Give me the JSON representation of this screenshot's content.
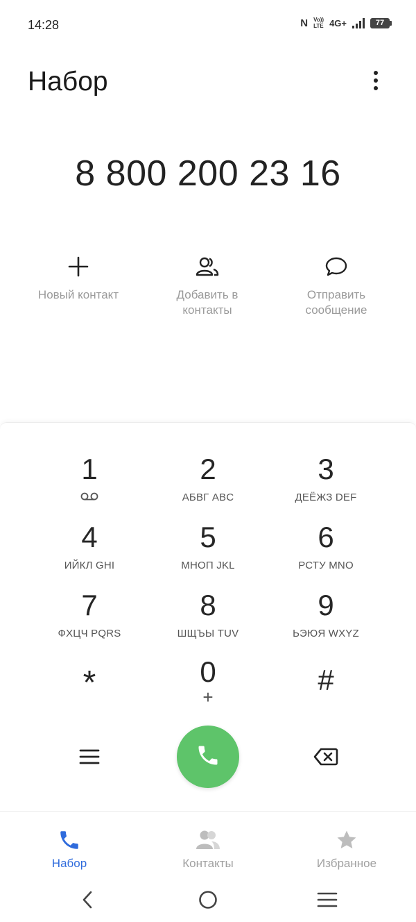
{
  "status_bar": {
    "time": "14:28",
    "nfc": "N",
    "volte_top": "Vo))",
    "volte_bottom": "LTE",
    "network": "4G+",
    "battery": "77"
  },
  "header": {
    "title": "Набор"
  },
  "dialed_number": "8 800 200 23 16",
  "actions": {
    "new_contact": "Новый контакт",
    "add_to_contacts": "Добавить в контакты",
    "send_message": "Отправить сообщение"
  },
  "keypad": [
    {
      "digit": "1",
      "letters": ""
    },
    {
      "digit": "2",
      "letters": "АБВГ ABC"
    },
    {
      "digit": "3",
      "letters": "ДЕЁЖЗ DEF"
    },
    {
      "digit": "4",
      "letters": "ИЙКЛ GHI"
    },
    {
      "digit": "5",
      "letters": "МНОП JKL"
    },
    {
      "digit": "6",
      "letters": "РСТУ MNO"
    },
    {
      "digit": "7",
      "letters": "ФХЦЧ PQRS"
    },
    {
      "digit": "8",
      "letters": "ШЩЪЫ TUV"
    },
    {
      "digit": "9",
      "letters": "ЬЭЮЯ WXYZ"
    },
    {
      "digit": "*",
      "letters": ""
    },
    {
      "digit": "0",
      "letters": "+"
    },
    {
      "digit": "#",
      "letters": ""
    }
  ],
  "bottom_nav": {
    "dial": "Набор",
    "contacts": "Контакты",
    "favorites": "Избранное"
  },
  "colors": {
    "call_green": "#5ec46a",
    "active_blue": "#2f6bdc",
    "inactive_gray": "#a0a0a0"
  }
}
